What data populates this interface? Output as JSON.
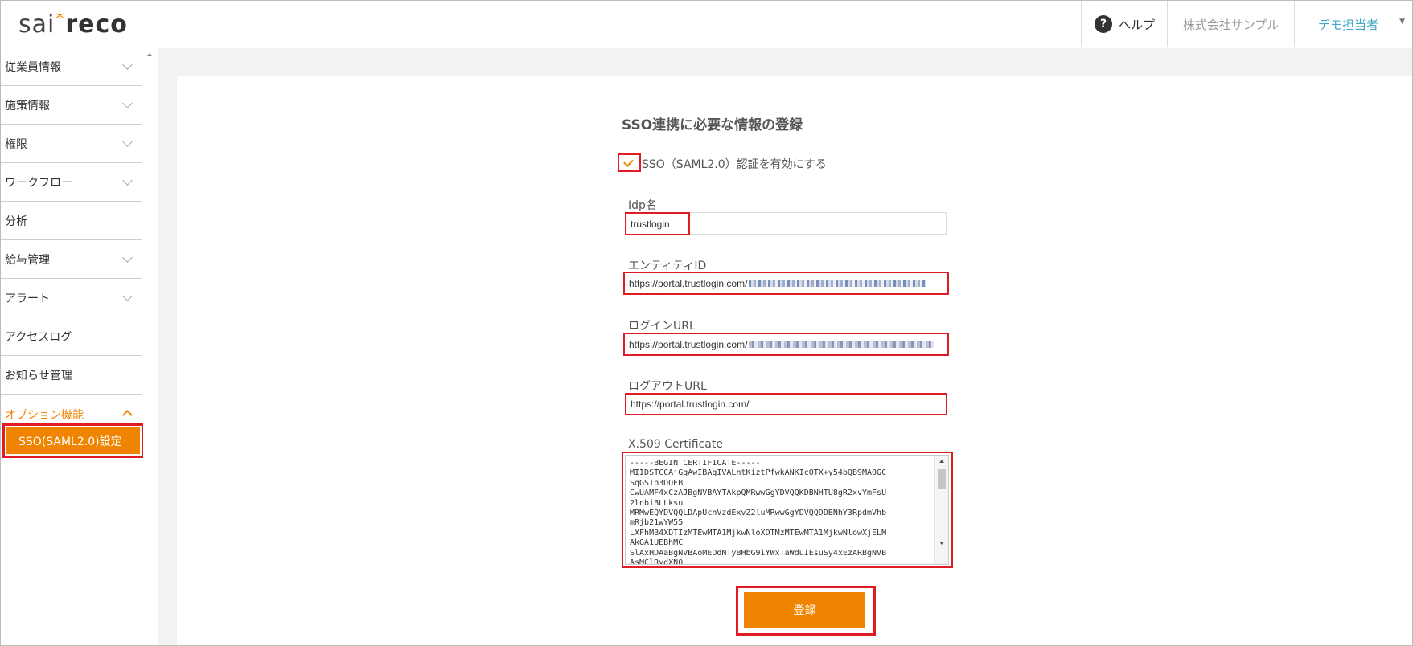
{
  "header": {
    "logo_part1": "sai",
    "logo_star": "*",
    "logo_part2": "reco",
    "help_icon_glyph": "?",
    "help_label": "ヘルプ",
    "company": "株式会社サンプル",
    "user": "デモ担当者"
  },
  "sidebar": {
    "items": [
      {
        "label": "従業員情報",
        "chevron": true
      },
      {
        "label": "施策情報",
        "chevron": true
      },
      {
        "label": "権限",
        "chevron": true
      },
      {
        "label": "ワークフロー",
        "chevron": true
      },
      {
        "label": "分析",
        "chevron": false
      },
      {
        "label": "給与管理",
        "chevron": true
      },
      {
        "label": "アラート",
        "chevron": true
      },
      {
        "label": "アクセスログ",
        "chevron": false
      },
      {
        "label": "お知らせ管理",
        "chevron": false
      },
      {
        "label": "オプション機能",
        "chevron": true,
        "active": true
      }
    ],
    "sub_item": "SSO(SAML2.0)設定"
  },
  "form": {
    "title": "SSO連携に必要な情報の登録",
    "enable_label": "SSO（SAML2.0）認証を有効にする",
    "enable_checked": true,
    "idp_label": "Idp名",
    "idp_value": "trustlogin",
    "entity_label": "エンティティID",
    "entity_value": "https://portal.trustlogin.com/",
    "login_label": "ログインURL",
    "login_value": "https://portal.trustlogin.com/",
    "logout_label": "ログアウトURL",
    "logout_value": "https://portal.trustlogin.com/",
    "cert_label": "X.509 Certificate",
    "cert_value": "-----BEGIN CERTIFICATE-----\nMIIDSTCCAjGgAwIBAgIVALntKiztPfwkANKIcOTX+y54bQB9MA0GC\nSqGSIb3DQEB\nCwUAMF4xCzAJBgNVBAYTAkpQMRwwGgYDVQQKDBNHTU8gR2xvYmFsU\n2lnbiBLLksu\nMRMwEQYDVQQLDApUcnVzdExvZ2luMRwwGgYDVQQDDBNhY3RpdmVhb\nmRjb21wYW55\nLXFhMB4XDTIzMTEwMTA1MjkwNloXDTMzMTEwMTA1MjkwNlowXjELM\nAkGA1UEBhMC\nSlAxHDAaBgNVBAoMEOdNTyBHbG9iYWxTaWduIEsuSy4xEzARBgNVB\nAsMClRydXN0",
    "submit_label": "登録"
  },
  "colors": {
    "accent": "#f08300",
    "highlight": "#e01b23",
    "user_link": "#42a8c8"
  }
}
